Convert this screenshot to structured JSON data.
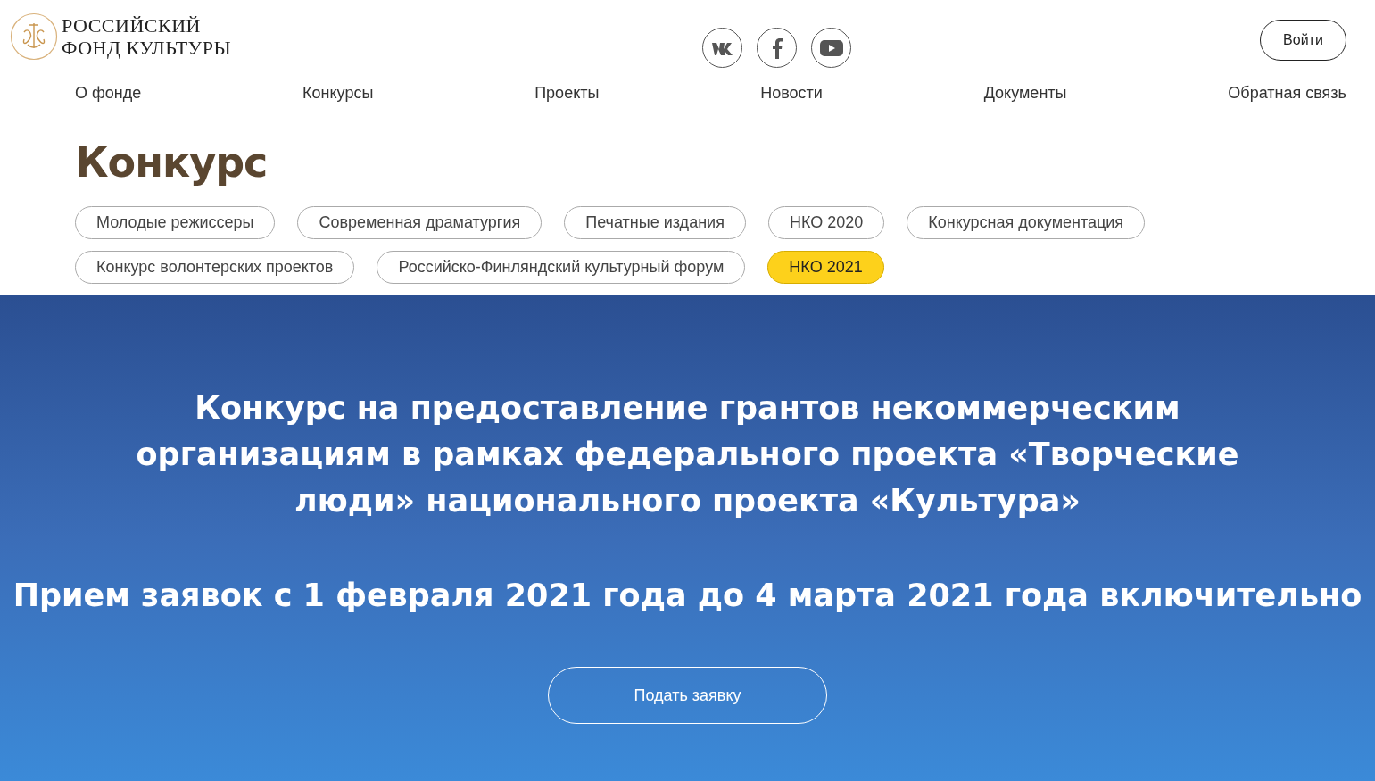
{
  "logo": {
    "line_1": "РОССИЙСКИЙ",
    "line_2": "ФОНД КУЛЬТУРЫ"
  },
  "login_button": "Войти",
  "nav": [
    "О фонде",
    "Конкурсы",
    "Проекты",
    "Новости",
    "Документы",
    "Обратная связь"
  ],
  "page_title": "Конкурс",
  "tags": [
    {
      "label": "Молодые режиссеры",
      "selected": false
    },
    {
      "label": "Современная драматургия",
      "selected": false
    },
    {
      "label": "Печатные издания",
      "selected": false
    },
    {
      "label": "НКО 2020",
      "selected": false
    },
    {
      "label": "Конкурсная документация",
      "selected": false
    },
    {
      "label": "Конкурс волонтерских проектов",
      "selected": false
    },
    {
      "label": "Российско-Финляндский культурный форум",
      "selected": false
    },
    {
      "label": "НКО 2021",
      "selected": true
    }
  ],
  "hero": {
    "title": "Конкурс на предоставление грантов некоммерческим организациям в рамках федерального проекта «Творческие люди» национального проекта «Культура»",
    "dates": "Прием заявок с 1 февраля 2021 года до 4 марта 2021 года включительно",
    "button": "Подать заявку"
  }
}
